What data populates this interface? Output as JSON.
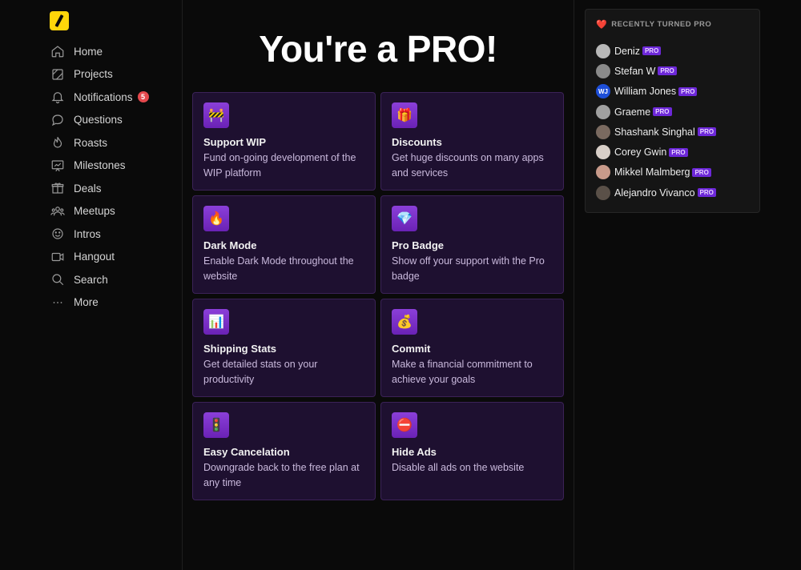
{
  "sidebar": {
    "items": [
      {
        "label": "Home",
        "icon": "home-icon"
      },
      {
        "label": "Projects",
        "icon": "projects-icon"
      },
      {
        "label": "Notifications",
        "icon": "bell-icon",
        "badge": "5"
      },
      {
        "label": "Questions",
        "icon": "chat-bubble-icon"
      },
      {
        "label": "Roasts",
        "icon": "flame-icon"
      },
      {
        "label": "Milestones",
        "icon": "chart-board-icon"
      },
      {
        "label": "Deals",
        "icon": "gift-icon"
      },
      {
        "label": "Meetups",
        "icon": "people-icon"
      },
      {
        "label": "Intros",
        "icon": "smiley-icon"
      },
      {
        "label": "Hangout",
        "icon": "video-icon"
      },
      {
        "label": "Search",
        "icon": "search-icon"
      },
      {
        "label": "More",
        "icon": "ellipsis-icon"
      }
    ]
  },
  "main": {
    "title": "You're a PRO!",
    "features": [
      {
        "emoji": "🚧",
        "title": "Support WIP",
        "desc": "Fund on-going development of the WIP platform"
      },
      {
        "emoji": "🎁",
        "title": "Discounts",
        "desc": "Get huge discounts on many apps and services"
      },
      {
        "emoji": "🔥",
        "title": "Dark Mode",
        "desc": "Enable Dark Mode throughout the website"
      },
      {
        "emoji": "💎",
        "title": "Pro Badge",
        "desc": "Show off your support with the Pro badge"
      },
      {
        "emoji": "📊",
        "title": "Shipping Stats",
        "desc": "Get detailed stats on your productivity"
      },
      {
        "emoji": "💰",
        "title": "Commit",
        "desc": "Make a financial commitment to achieve your goals"
      },
      {
        "emoji": "🚦",
        "title": "Easy Cancelation",
        "desc": "Downgrade back to the free plan at any time"
      },
      {
        "emoji": "⛔",
        "title": "Hide Ads",
        "desc": "Disable all ads on the website"
      }
    ]
  },
  "panel": {
    "heart": "❤️",
    "header": "RECENTLY TURNED PRO",
    "pro_label": "PRO",
    "users": [
      {
        "name": "Deniz",
        "avatar_color": "#b8b8b8"
      },
      {
        "name": "Stefan W",
        "avatar_color": "#8a8a8a"
      },
      {
        "name": "William Jones",
        "avatar_color": "#1d4ed8",
        "initials": "WJ"
      },
      {
        "name": "Graeme",
        "avatar_color": "#a0a0a0"
      },
      {
        "name": "Shashank Singhal",
        "avatar_color": "#7a6a60"
      },
      {
        "name": "Corey Gwin",
        "avatar_color": "#d8cfc8"
      },
      {
        "name": "Mikkel Malmberg",
        "avatar_color": "#c89a8a"
      },
      {
        "name": "Alejandro Vivanco",
        "avatar_color": "#5a5048"
      }
    ]
  }
}
